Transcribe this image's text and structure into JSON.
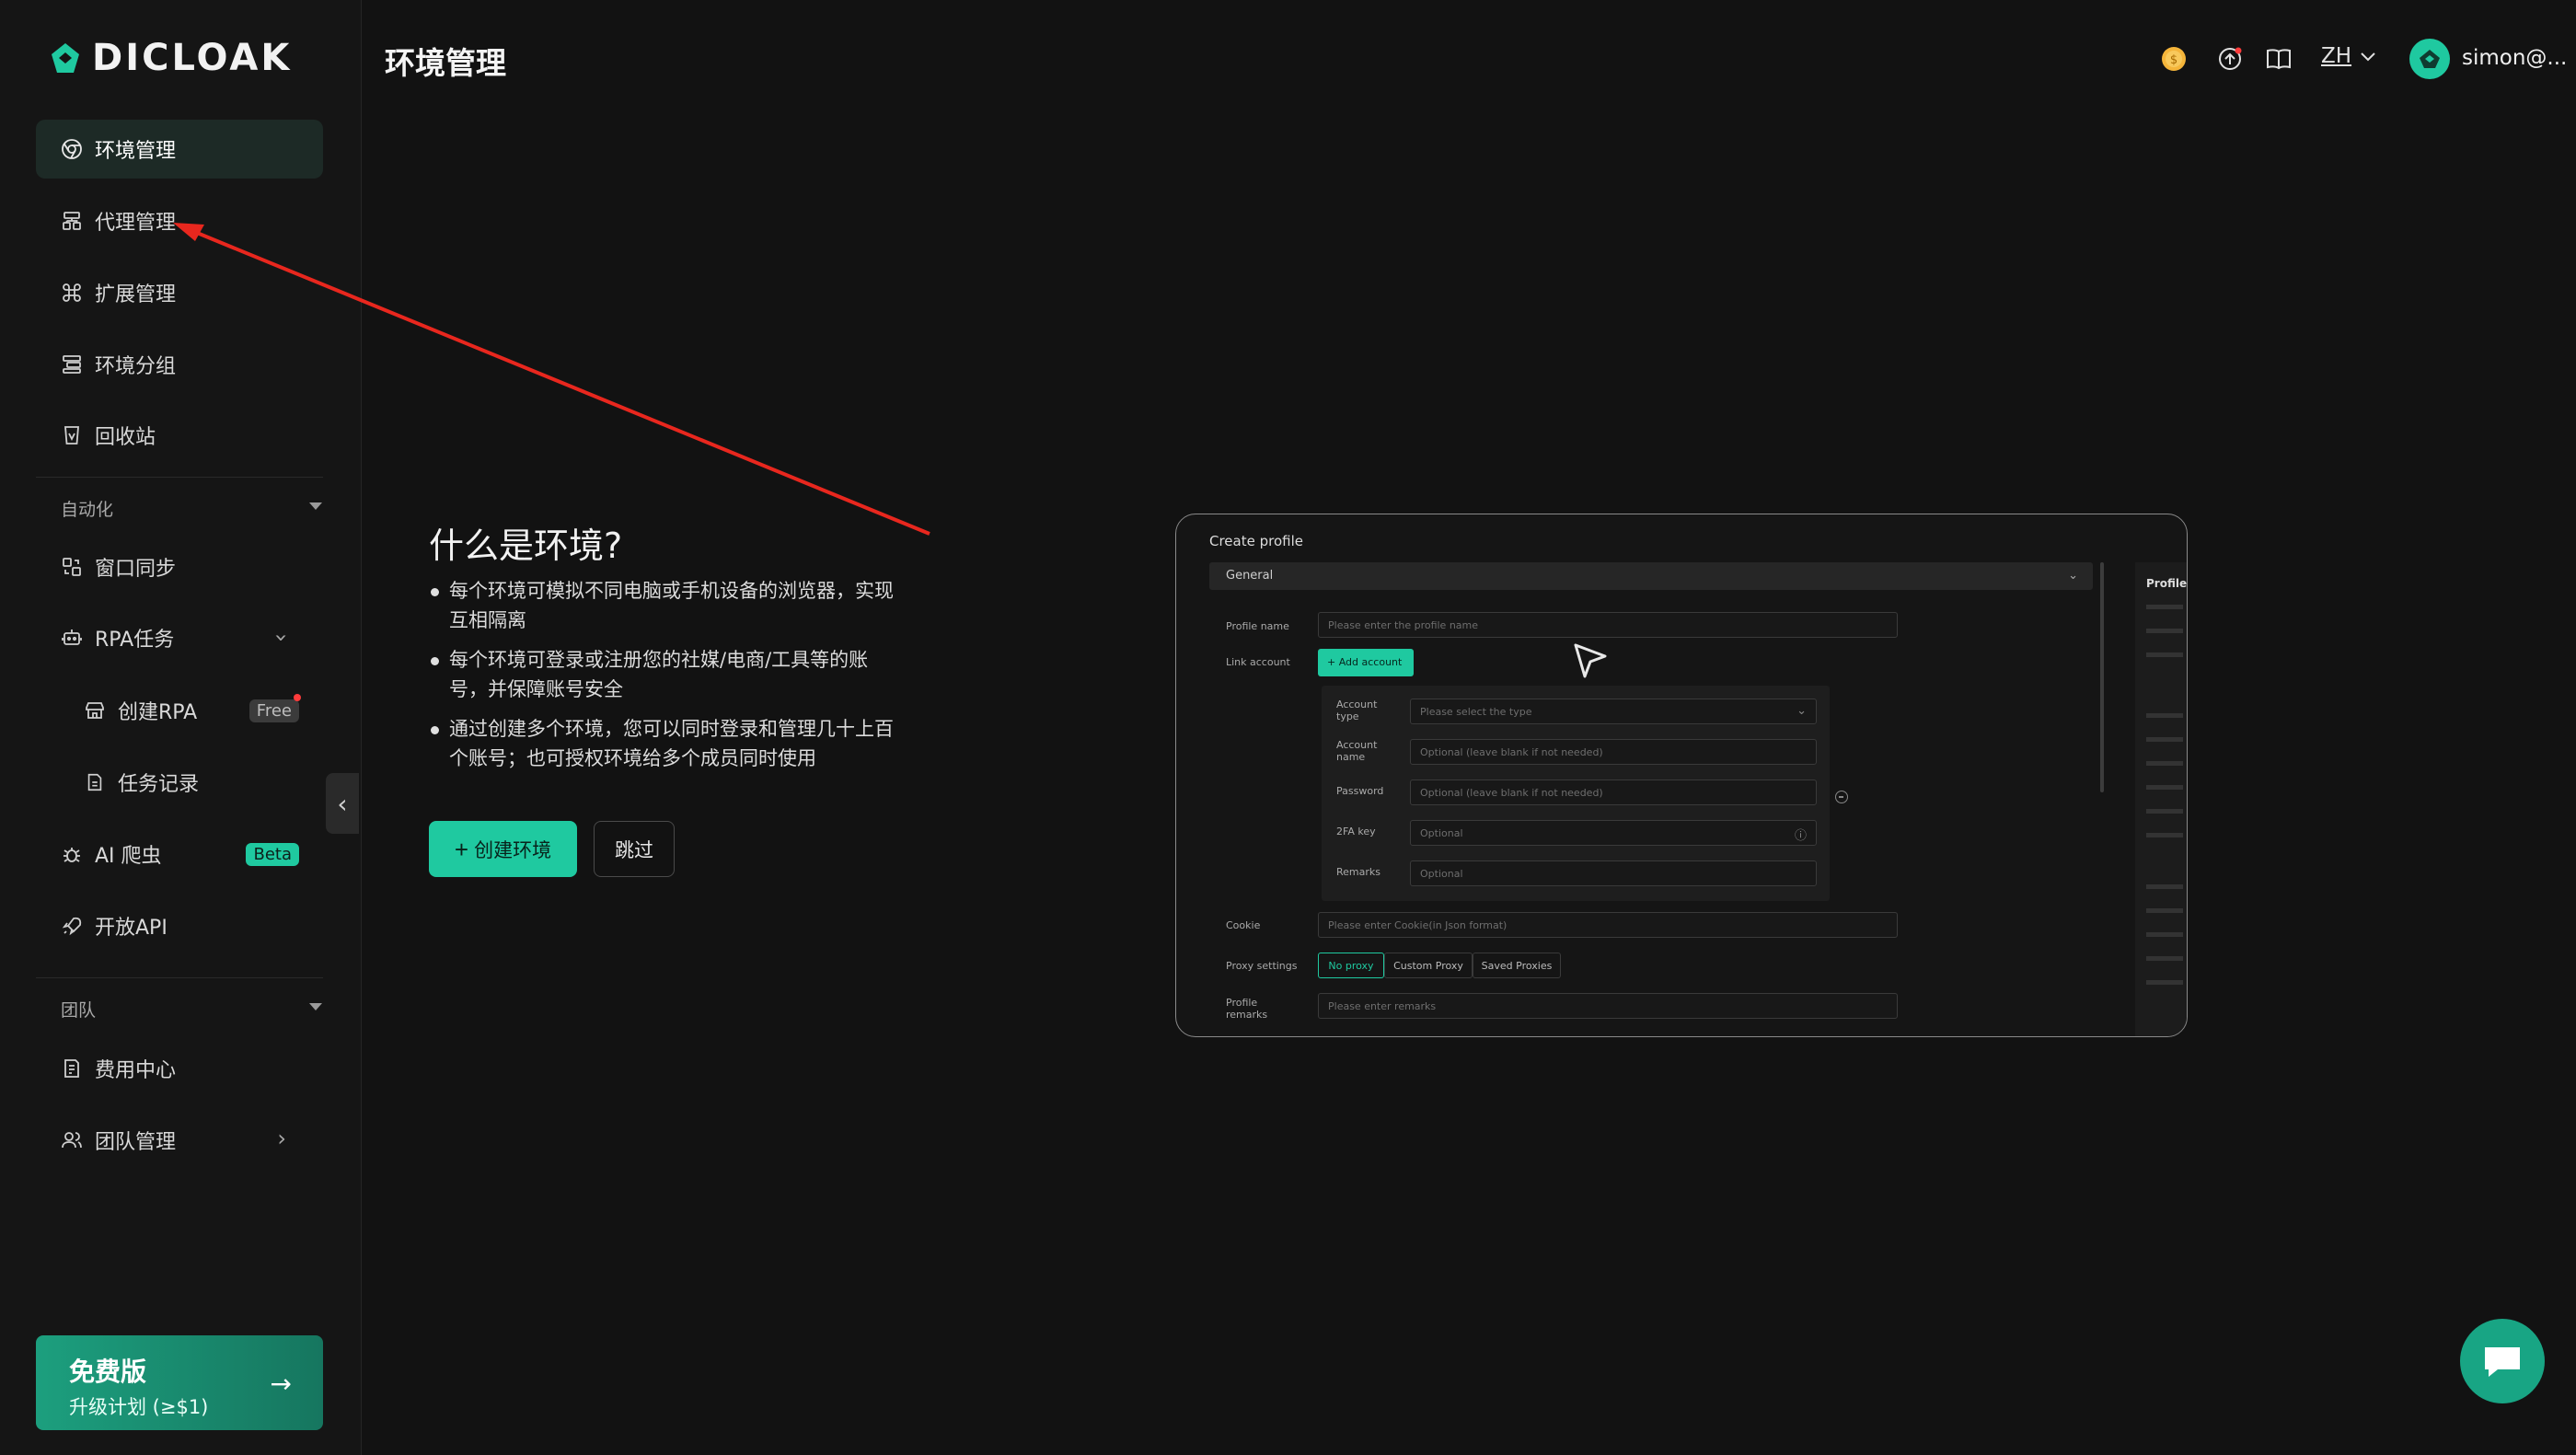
{
  "brand": {
    "name": "DICLOAK",
    "accent": "#1fc9a0"
  },
  "sidebar": {
    "items": [
      {
        "label": "环境管理",
        "icon": "chrome-icon",
        "active": true
      },
      {
        "label": "代理管理",
        "icon": "proxy-icon"
      },
      {
        "label": "扩展管理",
        "icon": "extension-icon"
      },
      {
        "label": "环境分组",
        "icon": "group-icon"
      },
      {
        "label": "回收站",
        "icon": "trash-icon"
      }
    ],
    "automation": {
      "label": "自动化",
      "items": [
        {
          "label": "窗口同步",
          "icon": "window-sync-icon"
        },
        {
          "label": "RPA任务",
          "icon": "robot-icon"
        },
        {
          "label": "创建RPA",
          "icon": "store-icon",
          "badge": "Free"
        },
        {
          "label": "任务记录",
          "icon": "document-icon"
        },
        {
          "label": "AI 爬虫",
          "icon": "bug-icon",
          "badge": "Beta"
        },
        {
          "label": "开放API",
          "icon": "rocket-icon"
        }
      ]
    },
    "team": {
      "label": "团队",
      "items": [
        {
          "label": "费用中心",
          "icon": "billing-icon"
        },
        {
          "label": "团队管理",
          "icon": "users-icon"
        }
      ]
    },
    "upgrade": {
      "title": "免费版",
      "subtitle": "升级计划 (≥$1)"
    }
  },
  "header": {
    "title": "环境管理",
    "lang": "ZH",
    "user": "simon@..."
  },
  "intro": {
    "title": "什么是环境?",
    "bullets": [
      "每个环境可模拟不同电脑或手机设备的浏览器，实现互相隔离",
      "每个环境可登录或注册您的社媒/电商/工具等的账号，并保障账号安全",
      "通过创建多个环境，您可以同时登录和管理几十上百个账号；也可授权环境给多个成员同时使用"
    ],
    "create_button": "创建环境",
    "skip_button": "跳过"
  },
  "preview": {
    "title": "Create profile",
    "section": "General",
    "side_title": "Profile",
    "labels": {
      "profile_name": "Profile name",
      "link_account": "Link account",
      "account_type": "Account type",
      "account_name": "Account name",
      "password": "Password",
      "twofa": "2FA key",
      "remarks": "Remarks",
      "cookie": "Cookie",
      "proxy_settings": "Proxy settings",
      "profile_remarks": "Profile remarks"
    },
    "placeholders": {
      "profile_name": "Please enter the profile name",
      "account_type": "Please select the type",
      "account_name": "Optional (leave blank if not needed)",
      "password": "Optional (leave blank if not needed)",
      "twofa": "Optional",
      "remarks": "Optional",
      "cookie": "Please enter Cookie(in Json format)",
      "profile_remarks": "Please enter remarks"
    },
    "add_account": "+ Add account",
    "proxy_tabs": [
      "No proxy",
      "Custom Proxy",
      "Saved Proxies"
    ]
  }
}
